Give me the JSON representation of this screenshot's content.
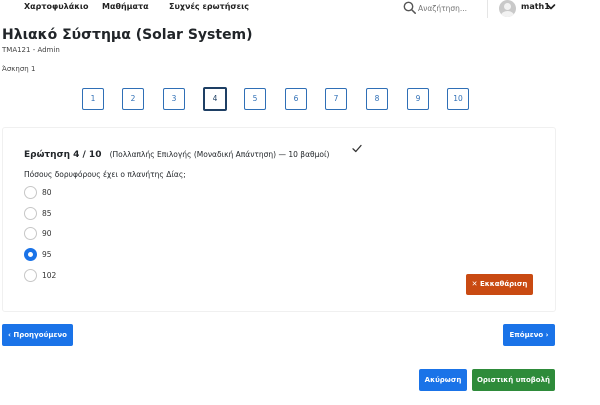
{
  "nav": {
    "links": [
      "Χαρτοφυλάκιο",
      "Μαθήματα",
      "Συχνές ερωτήσεις"
    ],
    "search_placeholder": "Αναζήτηση...",
    "username": "math1"
  },
  "page": {
    "title": "Ηλιακό Σύστημα (Solar System)",
    "subtitle": "TMA121 - Admin",
    "exercise": "Άσκηση 1"
  },
  "question_nav": {
    "items": [
      "1",
      "2",
      "3",
      "4",
      "5",
      "6",
      "7",
      "8",
      "9",
      "10"
    ],
    "active": "4"
  },
  "question": {
    "number": "Ερώτηση 4 / 10",
    "type": "(Πολλαπλής Επιλογής (Μοναδική Απάντηση) — 10 βαθμοί)",
    "text": "Πόσους δορυφόρους έχει ο πλανήτης Δίας;",
    "options": [
      "80",
      "85",
      "90",
      "95",
      "102"
    ],
    "selected": "95"
  },
  "buttons": {
    "clear": "✕ Εκκαθάριση",
    "prev": "‹ Προηγούμενο",
    "next": "Επόμενο ›",
    "cancel": "Ακύρωση",
    "submit": "Οριστική υποβολή"
  },
  "colors": {
    "primary": "#1a73e8",
    "danger": "#c94a12",
    "success": "#2e8b3a",
    "nav_border": "#2f6fb6"
  },
  "icons": {
    "search": "search-icon",
    "avatar": "user-avatar",
    "dropdown": "chevron-down-icon",
    "answered": "check-icon"
  }
}
